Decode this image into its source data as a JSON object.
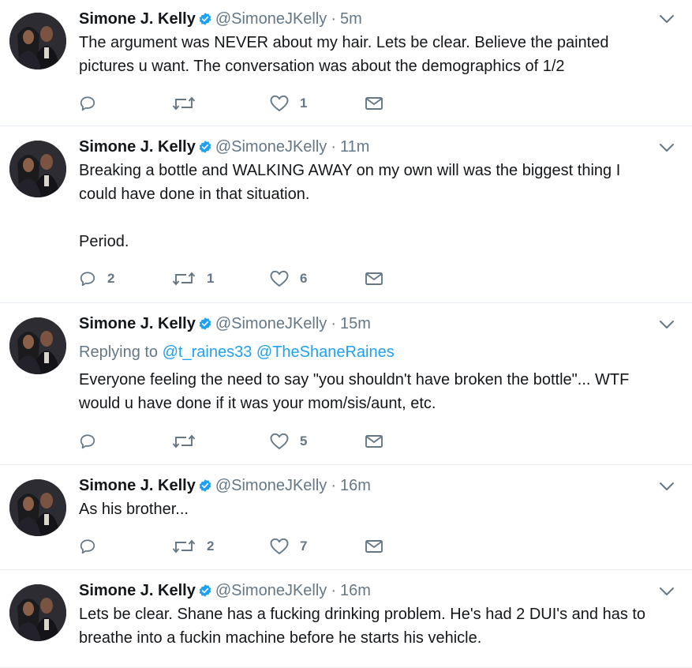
{
  "tweets": [
    {
      "name": "Simone J. Kelly",
      "handle": "@SimoneJKelly",
      "separator": "·",
      "time": "5m",
      "reply_prefix": "",
      "reply_users": [],
      "text": "The argument was NEVER about my hair. Lets be clear. Believe the painted pictures u want. The conversation was about the demographics of 1/2",
      "replies": "",
      "retweets": "",
      "likes": "1"
    },
    {
      "name": "Simone J. Kelly",
      "handle": "@SimoneJKelly",
      "separator": "·",
      "time": "11m",
      "reply_prefix": "",
      "reply_users": [],
      "text": "Breaking a bottle and WALKING AWAY on my own will was the biggest thing I could have done in that situation.\n\nPeriod.",
      "replies": "2",
      "retweets": "1",
      "likes": "6"
    },
    {
      "name": "Simone J. Kelly",
      "handle": "@SimoneJKelly",
      "separator": "·",
      "time": "15m",
      "reply_prefix": "Replying to",
      "reply_users": [
        "@t_raines33",
        "@TheShaneRaines"
      ],
      "text": "Everyone feeling the need to say \"you shouldn't have broken the bottle\"... WTF would u have done if it was your mom/sis/aunt, etc.",
      "replies": "",
      "retweets": "",
      "likes": "5"
    },
    {
      "name": "Simone J. Kelly",
      "handle": "@SimoneJKelly",
      "separator": "·",
      "time": "16m",
      "reply_prefix": "",
      "reply_users": [],
      "text": "As his brother...",
      "replies": "",
      "retweets": "2",
      "likes": "7"
    },
    {
      "name": "Simone J. Kelly",
      "handle": "@SimoneJKelly",
      "separator": "·",
      "time": "16m",
      "reply_prefix": "",
      "reply_users": [],
      "text": "Lets be clear. Shane has a fucking drinking problem. He's had 2 DUI's and has to breathe into a fuckin machine before he starts his vehicle.",
      "replies": "",
      "retweets": "",
      "likes": ""
    }
  ],
  "icons": {
    "verified": "verified-badge-icon",
    "more": "chevron-down-icon",
    "reply": "reply-icon",
    "retweet": "retweet-icon",
    "like": "heart-icon",
    "dm": "envelope-icon"
  },
  "colors": {
    "text": "#14171a",
    "secondary": "#657786",
    "link": "#1da1f2",
    "verified": "#1da1f2",
    "divider": "#e6ecf0"
  }
}
